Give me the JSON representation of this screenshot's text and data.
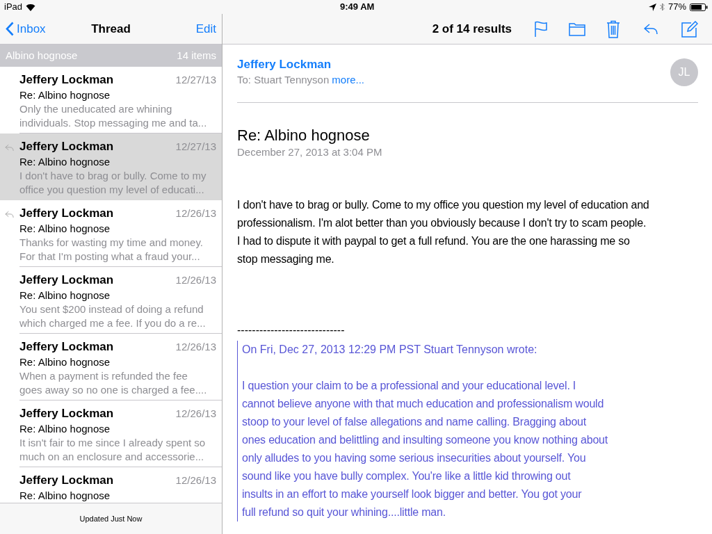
{
  "status_bar": {
    "device": "iPad",
    "time": "9:49 AM",
    "battery": "77%"
  },
  "sidebar": {
    "back": "Inbox",
    "title": "Thread",
    "edit": "Edit",
    "section": {
      "title": "Albino hognose",
      "count": "14 items"
    },
    "messages": [
      {
        "sender": "Jeffery Lockman",
        "date": "12/27/13",
        "subject": "Re: Albino hognose",
        "preview": [
          "Only the uneducated are whining",
          "individuals. Stop messaging me and ta..."
        ],
        "replied": false,
        "selected": false
      },
      {
        "sender": "Jeffery Lockman",
        "date": "12/27/13",
        "subject": "Re: Albino hognose",
        "preview": [
          "I don't have to brag or bully. Come to my",
          "office you question my level of educati..."
        ],
        "replied": true,
        "selected": true
      },
      {
        "sender": "Jeffery Lockman",
        "date": "12/26/13",
        "subject": "Re: Albino hognose",
        "preview": [
          "Thanks for wasting my time and money.",
          "For that I'm posting what a fraud your..."
        ],
        "replied": true,
        "selected": false
      },
      {
        "sender": "Jeffery Lockman",
        "date": "12/26/13",
        "subject": "Re: Albino hognose",
        "preview": [
          "You sent $200 instead of doing a refund",
          "which charged me a fee. If you do a re..."
        ],
        "replied": false,
        "selected": false
      },
      {
        "sender": "Jeffery Lockman",
        "date": "12/26/13",
        "subject": "Re: Albino hognose",
        "preview": [
          "When a payment is refunded the fee",
          "goes away so no one is charged a fee...."
        ],
        "replied": false,
        "selected": false
      },
      {
        "sender": "Jeffery Lockman",
        "date": "12/26/13",
        "subject": "Re: Albino hognose",
        "preview": [
          "It isn't fair to me since I already spent so",
          "much on an enclosure and accessorie..."
        ],
        "replied": false,
        "selected": false
      },
      {
        "sender": "Jeffery Lockman",
        "date": "12/26/13",
        "subject": "Re: Albino hognose",
        "replied": false,
        "selected": false
      }
    ],
    "footer": "Updated Just Now"
  },
  "toolbar": {
    "results": "2 of 14 results"
  },
  "message": {
    "from": "Jeffery Lockman",
    "to": "To: Stuart Tennyson",
    "more": "more...",
    "avatar": "JL",
    "subject": "Re: Albino hognose",
    "date": "December 27, 2013 at 3:04 PM",
    "body": [
      "I don't have to brag or bully. Come to my office you question my level of education and",
      "professionalism.  I'm alot better than you obviously because I don't try to scam people.",
      "I had to dispute it with paypal to get a full refund. You are the one harassing me so",
      "stop messaging me."
    ],
    "separator": "-----------------------------",
    "quote": {
      "header": "On Fri, Dec 27, 2013 12:29 PM PST Stuart Tennyson wrote:",
      "body": [
        "I question your claim to be a professional and your educational level.  I",
        "cannot believe anyone with that much education and professionalism would",
        "stoop to your level of false allegations and name calling.  Bragging about",
        "ones education and belittling and insulting someone you know nothing about",
        "only alludes to you having some serious insecurities about yourself.  You",
        "sound like you have bully complex.  You're like a little kid throwing out",
        "insults in an effort to make yourself look bigger and better.  You got your",
        "full refund so quit your whining....little man."
      ]
    }
  }
}
